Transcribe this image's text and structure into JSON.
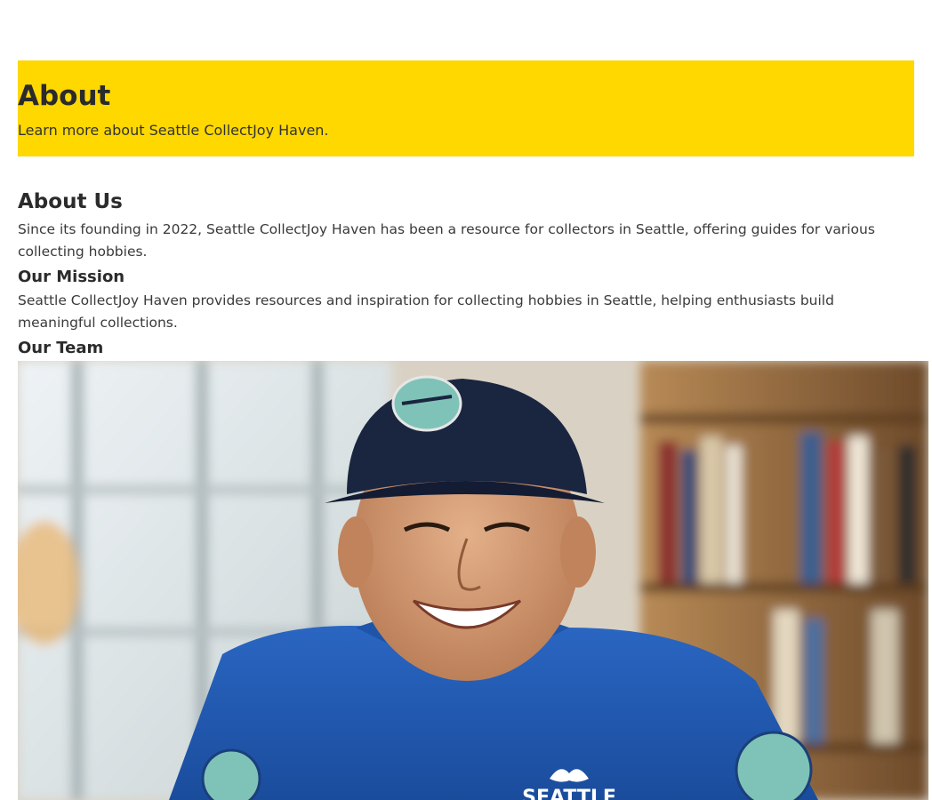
{
  "hero": {
    "title": "About",
    "subtitle": "Learn more about Seattle CollectJoy Haven."
  },
  "about": {
    "heading": "About Us",
    "text": "Since its founding in 2022, Seattle CollectJoy Haven has been a resource for collectors in Seattle, offering guides for various collecting hobbies."
  },
  "mission": {
    "heading": "Our Mission",
    "text": "Seattle CollectJoy Haven provides resources and inspiration for collecting hobbies in Seattle, helping enthusiasts build meaningful collections."
  },
  "team": {
    "heading": "Our Team",
    "shirt_text": "SEATTLE"
  },
  "colors": {
    "hero_bg": "#ffd800",
    "shirt": "#1f5bb5",
    "cap": "#1a2540"
  }
}
